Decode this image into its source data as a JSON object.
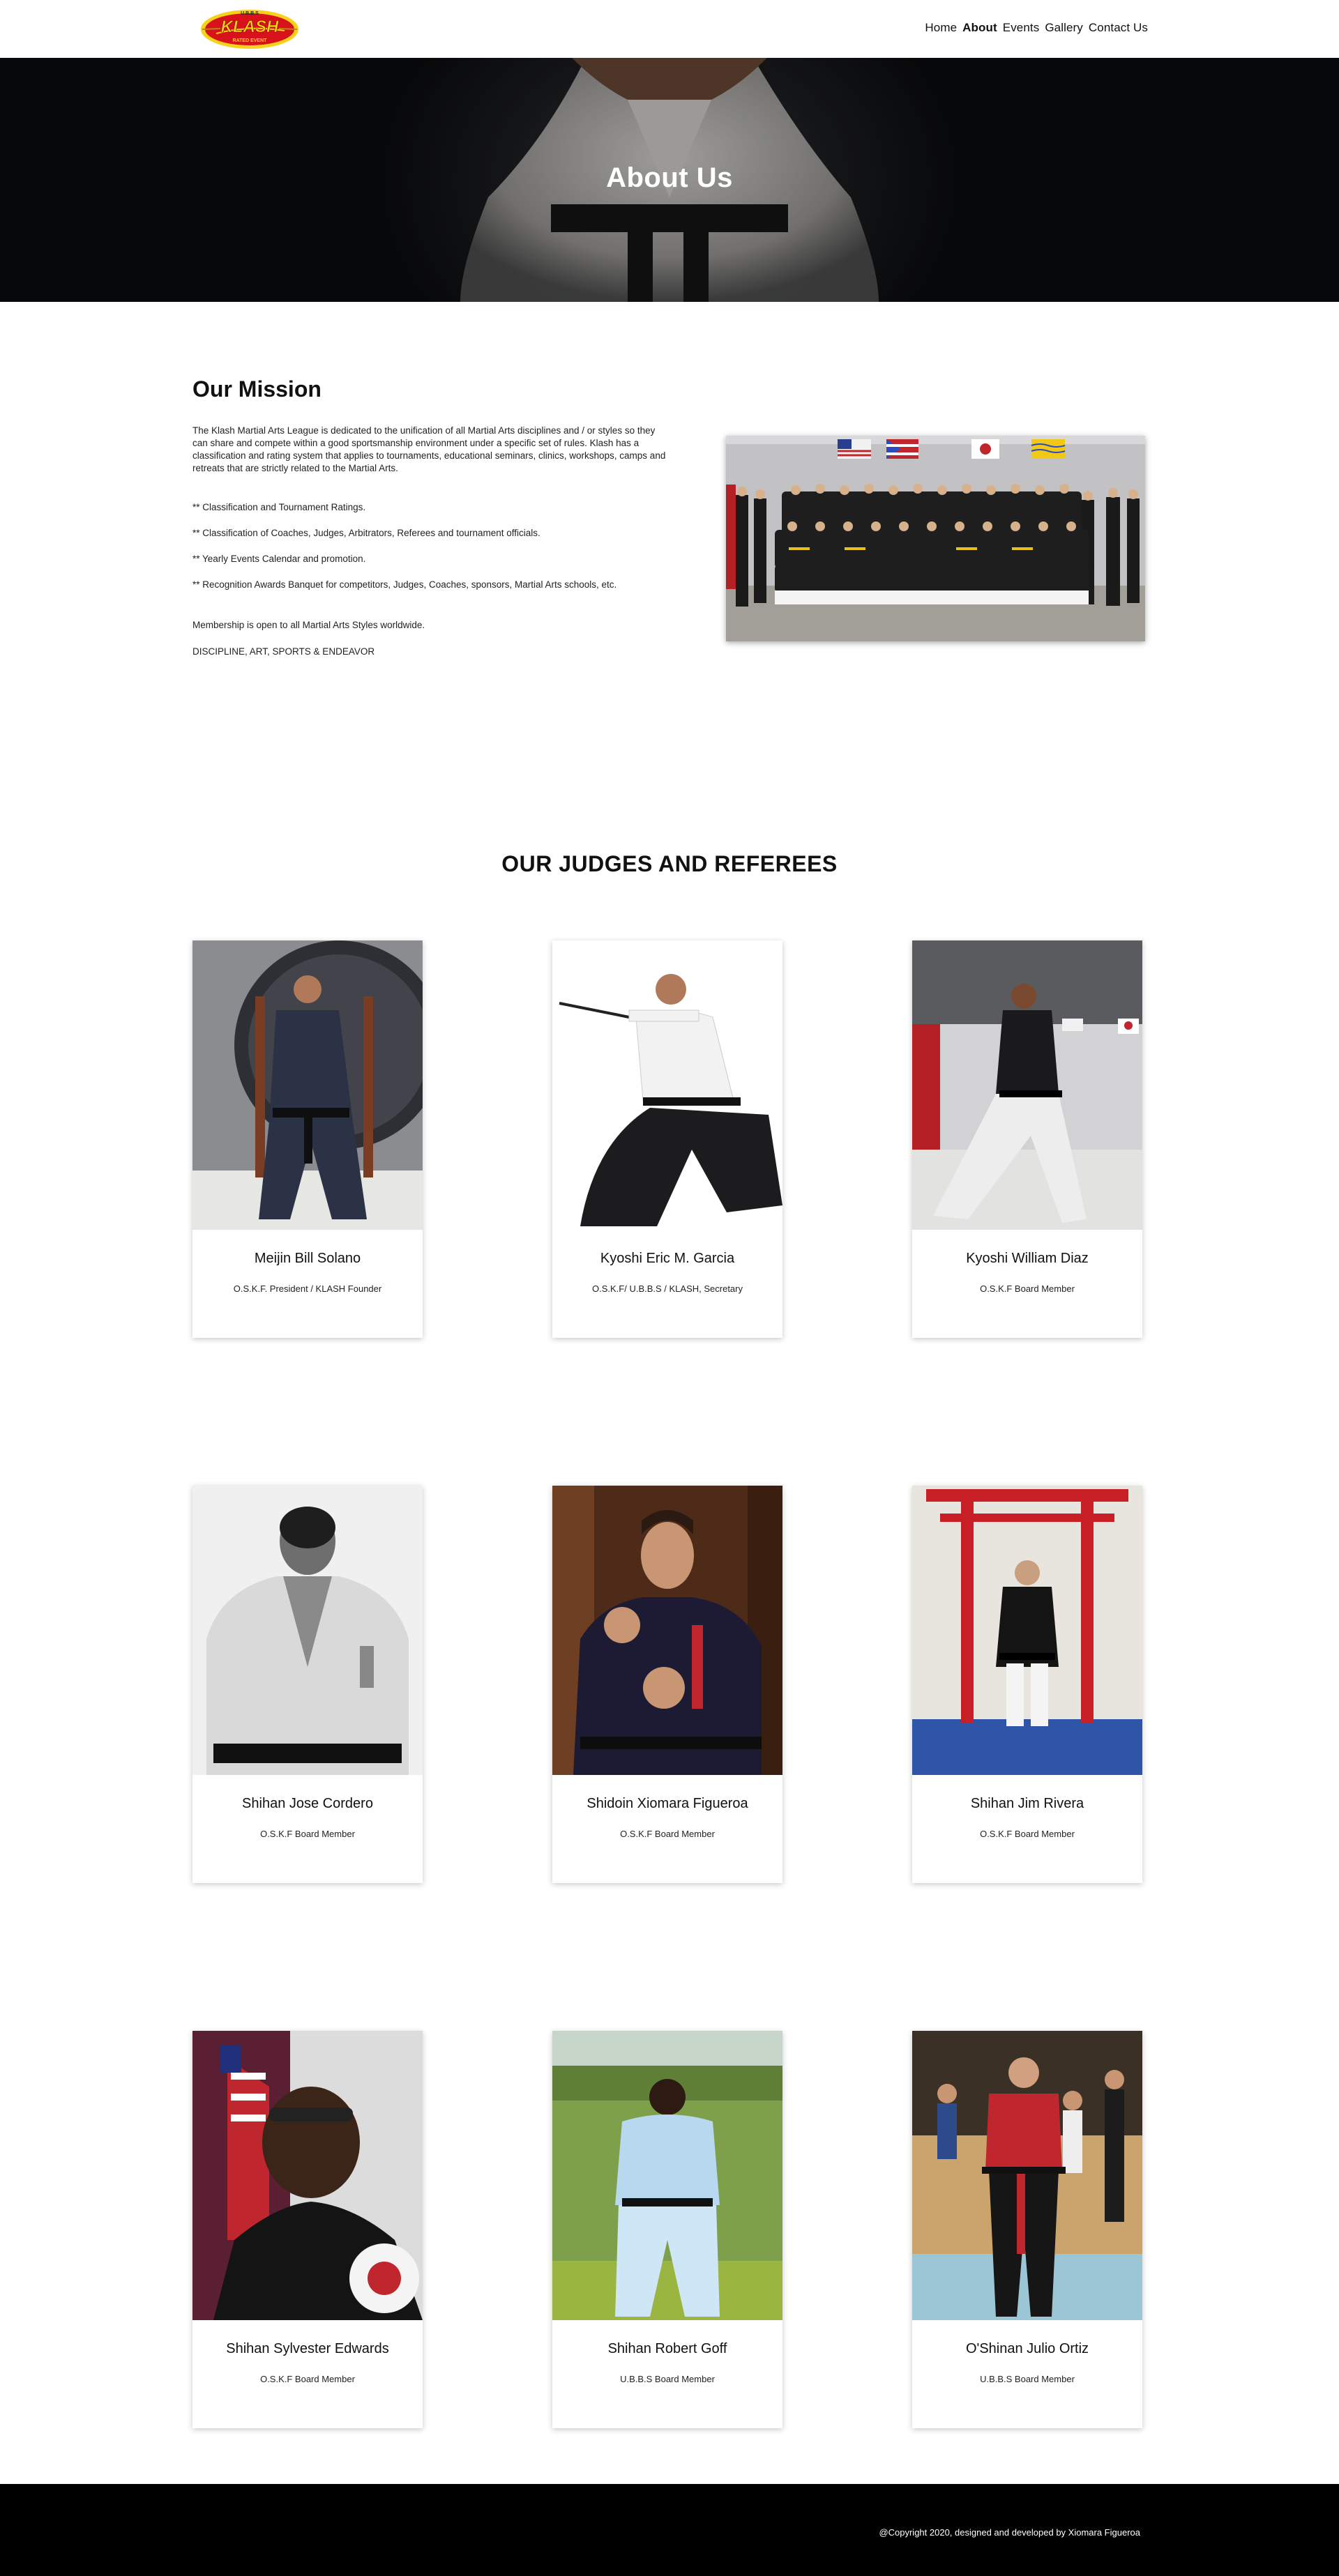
{
  "header": {
    "logo_text": "KLASH",
    "logo_top": "U.B.B.S",
    "logo_bottom": "RATED EVENT",
    "nav": [
      "Home",
      "About",
      "Events",
      "Gallery",
      "Contact Us"
    ],
    "active_nav": "About"
  },
  "hero": {
    "title": "About Us"
  },
  "mission": {
    "title": "Our Mission",
    "intro": "The Klash Martial Arts League is dedicated to the unification of all Martial Arts disciplines and / or styles so they can share and compete within a good sportsmanship environment under a specific set of rules. Klash has a classification and rating system that applies to tournaments, educational seminars, clinics, workshops, camps and retreats that are strictly related to the Martial Arts.",
    "items": [
      "** Classification and Tournament Ratings.",
      "** Classification of Coaches, Judges, Arbitrators, Referees and tournament officials.",
      "** Yearly Events Calendar and promotion.",
      "** Recognition Awards Banquet for competitors, Judges, Coaches, sponsors, Martial Arts schools, etc."
    ],
    "membership": "Membership is open to all Martial Arts Styles worldwide.",
    "motto": "DISCIPLINE, ART, SPORTS & ENDEAVOR"
  },
  "judges": {
    "title": "OUR JUDGES AND REFEREES",
    "members": [
      {
        "name": "Meijin Bill Solano",
        "role": "O.S.K.F. President / KLASH Founder"
      },
      {
        "name": "Kyoshi Eric M. Garcia",
        "role": "O.S.K.F/ U.B.B.S / KLASH, Secretary"
      },
      {
        "name": "Kyoshi William Diaz",
        "role": "O.S.K.F Board Member"
      },
      {
        "name": "Shihan Jose Cordero",
        "role": "O.S.K.F Board Member"
      },
      {
        "name": "Shidoin Xiomara Figueroa",
        "role": "O.S.K.F Board Member"
      },
      {
        "name": "Shihan Jim Rivera",
        "role": "O.S.K.F Board Member"
      },
      {
        "name": "Shihan Sylvester Edwards",
        "role": "O.S.K.F Board Member"
      },
      {
        "name": "Shihan Robert Goff",
        "role": "U.B.B.S Board Member"
      },
      {
        "name": "O'Shinan Julio Ortiz",
        "role": "U.B.B.S Board Member"
      }
    ]
  },
  "footer": {
    "copyright": "@Copyright 2020, designed and developed by Xiomara Figueroa"
  },
  "colors": {
    "footer": "#000000",
    "logo_red": "#d8121b",
    "logo_yellow": "#f6d21a"
  }
}
